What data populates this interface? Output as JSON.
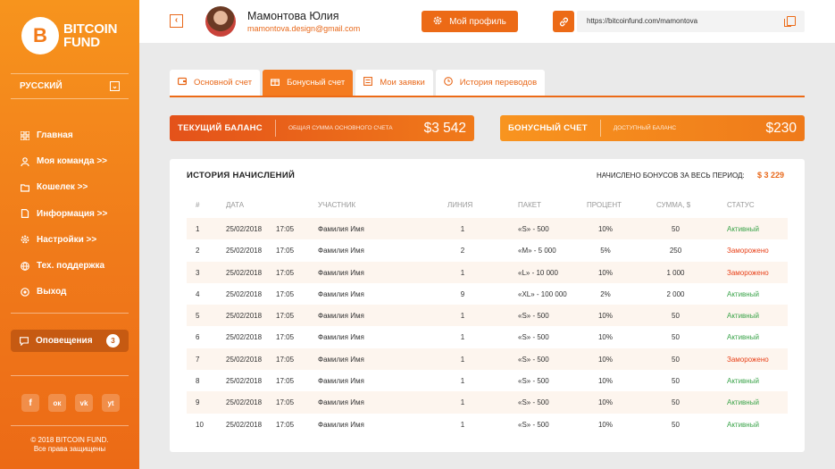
{
  "brand": {
    "logo_letter": "B",
    "name_line1": "BITCOIN",
    "name_line2": "FUND"
  },
  "language": {
    "label": "РУССКИЙ"
  },
  "nav": [
    {
      "label": "Главная",
      "icon": "grid-icon"
    },
    {
      "label": "Моя команда >>",
      "icon": "user-icon"
    },
    {
      "label": "Кошелек >>",
      "icon": "folder-icon"
    },
    {
      "label": "Информация >>",
      "icon": "document-icon"
    },
    {
      "label": "Настройки >>",
      "icon": "gear-icon"
    },
    {
      "label": "Тех. поддержка",
      "icon": "globe-icon"
    },
    {
      "label": "Выход",
      "icon": "power-icon"
    }
  ],
  "notifications": {
    "label": "Оповещения",
    "count": "3"
  },
  "socials": [
    "f",
    "ок",
    "vk",
    "yt"
  ],
  "footer": {
    "line1": "© 2018 BITCOIN FUND.",
    "line2": "Все права защищены"
  },
  "header": {
    "user_name": "Мамонтова Юлия",
    "user_email": "mamontova.design@gmail.com",
    "profile_button": "Мой профиль",
    "ref_url": "https://bitcoinfund.com/mamontova"
  },
  "tabs": [
    {
      "label": "Основной счет",
      "active": false
    },
    {
      "label": "Бонусный счет",
      "active": true
    },
    {
      "label": "Мои заявки",
      "active": false
    },
    {
      "label": "История переводов",
      "active": false
    }
  ],
  "balance_cards": [
    {
      "title": "ТЕКУЩИЙ БАЛАНС",
      "subtitle": "ОБЩАЯ СУММА ОСНОВНОГО СЧЕТА",
      "value": "$3 542"
    },
    {
      "title": "БОНУСНЫЙ СЧЕТ",
      "subtitle": "ДОСТУПНЫЙ БАЛАНС",
      "value": "$230"
    }
  ],
  "history": {
    "title": "ИСТОРИЯ НАЧИСЛЕНИЙ",
    "total_label": "НАЧИСЛЕНО БОНУСОВ ЗА ВЕСЬ ПЕРИОД:",
    "total_value": "$ 3 229",
    "columns": [
      "#",
      "ДАТА",
      "УЧАСТНИК",
      "ЛИНИЯ",
      "ПАКЕТ",
      "ПРОЦЕНТ",
      "СУММА, $",
      "СТАТУС"
    ],
    "rows": [
      {
        "n": "1",
        "date": "25/02/2018",
        "time": "17:05",
        "participant": "Фамилия Имя",
        "line": "1",
        "package": "«S» - 500",
        "percent": "10%",
        "sum": "50",
        "status": "Активный"
      },
      {
        "n": "2",
        "date": "25/02/2018",
        "time": "17:05",
        "participant": "Фамилия Имя",
        "line": "2",
        "package": "«M» - 5 000",
        "percent": "5%",
        "sum": "250",
        "status": "Заморожено"
      },
      {
        "n": "3",
        "date": "25/02/2018",
        "time": "17:05",
        "participant": "Фамилия Имя",
        "line": "1",
        "package": "«L» - 10 000",
        "percent": "10%",
        "sum": "1 000",
        "status": "Заморожено"
      },
      {
        "n": "4",
        "date": "25/02/2018",
        "time": "17:05",
        "participant": "Фамилия Имя",
        "line": "9",
        "package": "«XL» - 100 000",
        "percent": "2%",
        "sum": "2 000",
        "status": "Активный"
      },
      {
        "n": "5",
        "date": "25/02/2018",
        "time": "17:05",
        "participant": "Фамилия Имя",
        "line": "1",
        "package": "«S» - 500",
        "percent": "10%",
        "sum": "50",
        "status": "Активный"
      },
      {
        "n": "6",
        "date": "25/02/2018",
        "time": "17:05",
        "participant": "Фамилия Имя",
        "line": "1",
        "package": "«S» - 500",
        "percent": "10%",
        "sum": "50",
        "status": "Активный"
      },
      {
        "n": "7",
        "date": "25/02/2018",
        "time": "17:05",
        "participant": "Фамилия Имя",
        "line": "1",
        "package": "«S» - 500",
        "percent": "10%",
        "sum": "50",
        "status": "Заморожено"
      },
      {
        "n": "8",
        "date": "25/02/2018",
        "time": "17:05",
        "participant": "Фамилия Имя",
        "line": "1",
        "package": "«S» - 500",
        "percent": "10%",
        "sum": "50",
        "status": "Активный"
      },
      {
        "n": "9",
        "date": "25/02/2018",
        "time": "17:05",
        "participant": "Фамилия Имя",
        "line": "1",
        "package": "«S» - 500",
        "percent": "10%",
        "sum": "50",
        "status": "Активный"
      },
      {
        "n": "10",
        "date": "25/02/2018",
        "time": "17:05",
        "participant": "Фамилия Имя",
        "line": "1",
        "package": "«S» - 500",
        "percent": "10%",
        "sum": "50",
        "status": "Активный"
      }
    ]
  },
  "colors": {
    "accent": "#ec6a16",
    "status_active": "#3aa349",
    "status_frozen": "#e8421a"
  }
}
